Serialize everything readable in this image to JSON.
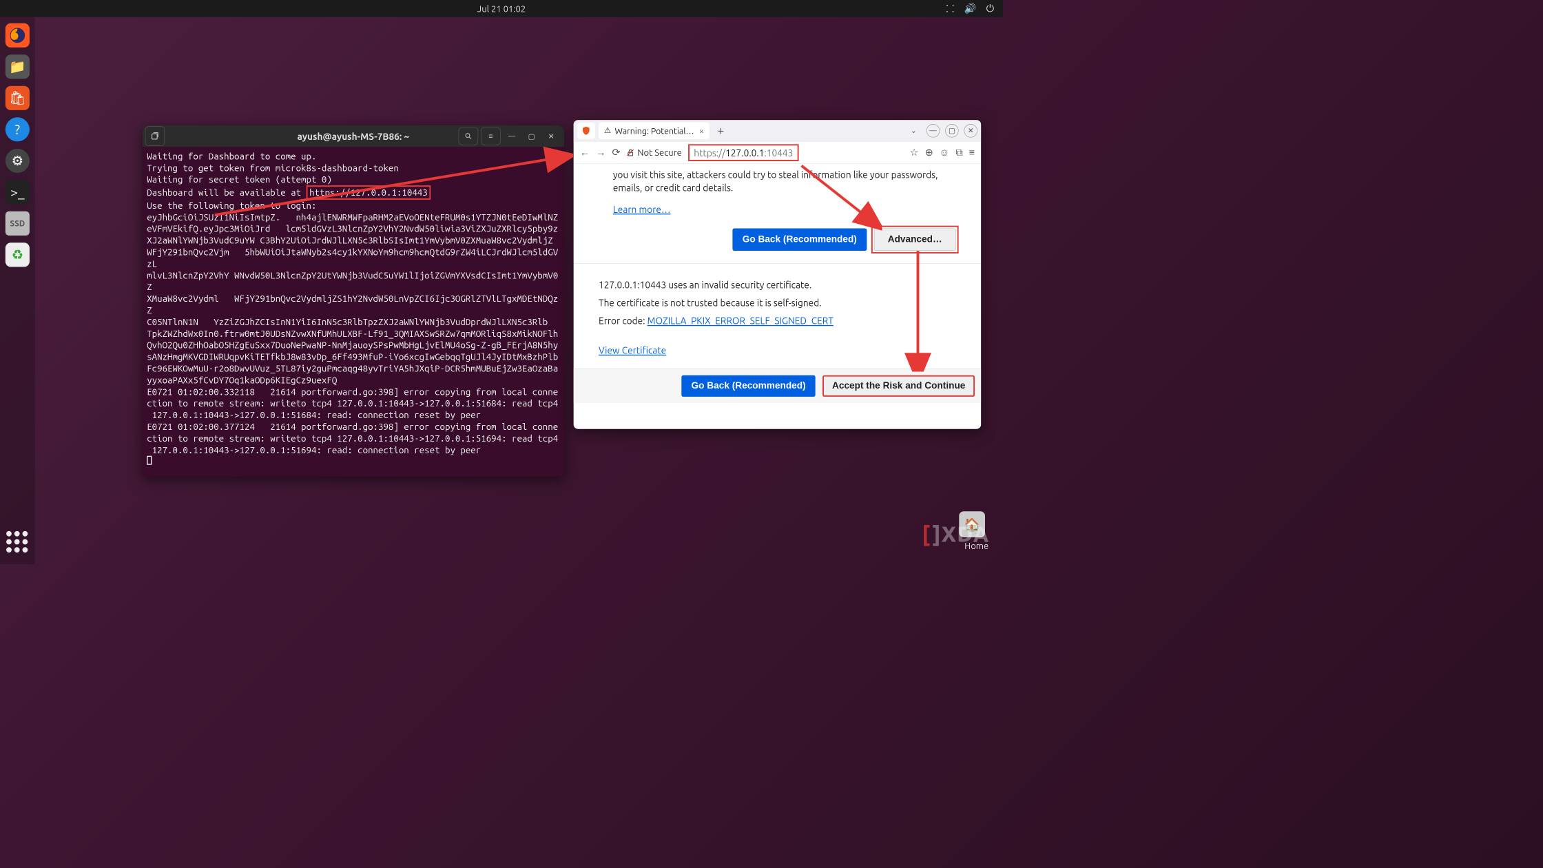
{
  "topbar": {
    "clock": "Jul 21  01:02"
  },
  "dock": {
    "ssd_label": "SSD"
  },
  "terminal": {
    "title": "ayush@ayush-MS-7B86: ~",
    "lines_pre": "Waiting for Dashboard to come up.\nTrying to get token from microk8s-dashboard-token\nWaiting for secret token (attempt 0)\nDashboard will be available at ",
    "url": "https://127.0.0.1:10443",
    "lines_post": "\nUse the following token to login:\neyJhbGciOiJSUzI1NiIsImtpZ.   nh4ajlENWRMWFpaRHM2aEVoOENteFRUM0s1YTZJN0tEeDIwMlNZ\neVFmVEkifQ.eyJpc3MiOiJrd   lcm5ldGVzL3NlcnZpY2VhY2NvdW50liwia3ViZXJuZXRlcy5pby9z\nXJ2aWNlYWNjb3VudC9uYW C3BhY2UiOiJrdWJlLXN5c3RlbSIsImt1YmVybmV0ZXMuaW8vc2VydmljZ\nWFjY291bnQvc2Vjm   5hbWUiOiJtaWNyb2s4cy1kYXNoYm9hcm9hcmQtdG9rZW4iLCJrdWJlcm5ldGVzL\nmlvL3NlcnZpY2VhY WNvdW50L3NlcnZpY2UtYWNjb3VudC5uYW1lIjoiZGVmYXVsdCIsImt1YmVybmV0Z\nXMuaW8vc2Vydml   WFjY291bnQvc2VydmljZS1hY2NvdW50LnVpZCI6Ijc3OGRlZTVlLTgxMDEtNDQzZ\nC05NTlnN1N   YzZiZGJhZCIsInN1YiI6InN5c3RlbTpzZXJ2aWNlYWNjb3VudDprdWJlLXN5c3Rlb\nTpkZWZhdWx0In0.ftrw0mtJ0UDsNZvwXNfUMhULXBF-Lf91_3QMIAXSwSRZw7qmMORliqS8xMikNOFlh\nQvhO2Qu0ZHhOabO5HZgEuSxx7DuoNePwaNP-NnMjauoySPsPwMbHgLjvElMU4oSg-Z-gB_FErjA8N5hy\nsANzHmgMKVGDIWRUqpvKiTETfkbJ8w83vDp_6Ff493MfuP-iYo6xcgIwGebqqTgUJl4JyIDtMxBzhPlb\nFc96EWKOwMuU-r2o8DwvUVuz_5TL87iy2guPmcaqg48yvTriYA5hJXqiP-DCR5hmMUBuEjZw3EaOzaBa\nyyxoaPAXx5fCvDY7Oq1kaODp6KIEgCz9uexFQ\nE0721 01:02:00.332118   21614 portforward.go:398] error copying from local conne\nction to remote stream: writeto tcp4 127.0.0.1:10443->127.0.0.1:51684: read tcp4\n 127.0.0.1:10443->127.0.0.1:51684: read: connection reset by peer\nE0721 01:02:00.377124   21614 portforward.go:398] error copying from local conne\nction to remote stream: writeto tcp4 127.0.0.1:10443->127.0.0.1:51694: read tcp4\n 127.0.0.1:10443->127.0.0.1:51694: read: connection reset by peer"
  },
  "firefox": {
    "tab_title": "Warning: Potential Secur",
    "not_secure": "Not Secure",
    "url_prefix": "https://",
    "url_host": "127.0.0.1",
    "url_port": ":10443",
    "warning_body": "you visit this site, attackers could try to steal information like your passwords, emails, or credit card details.",
    "learn_more": "Learn more…",
    "go_back": "Go Back (Recommended)",
    "advanced": "Advanced…",
    "cert_line1": "127.0.0.1:10443 uses an invalid security certificate.",
    "cert_line2": "The certificate is not trusted because it is self-signed.",
    "error_code_label": "Error code: ",
    "error_code": "MOZILLA_PKIX_ERROR_SELF_SIGNED_CERT",
    "view_cert": "View Certificate",
    "go_back2": "Go Back (Recommended)",
    "accept_risk": "Accept the Risk and Continue"
  },
  "desktop": {
    "home_label": "Home",
    "watermark": "XDA"
  }
}
